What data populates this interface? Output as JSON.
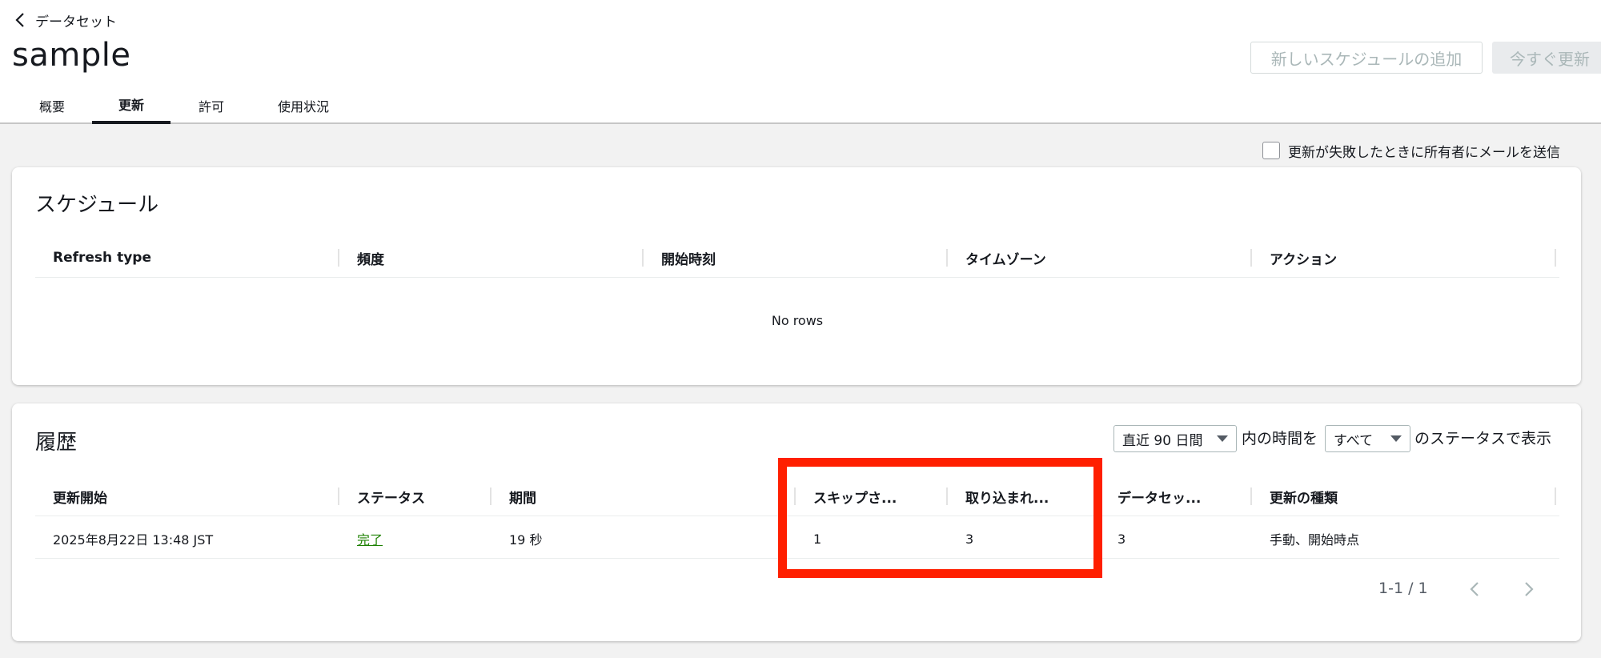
{
  "header": {
    "back_label": "データセット",
    "title": "sample",
    "add_schedule_label": "新しいスケジュールの追加",
    "refresh_now_label": "今すぐ更新"
  },
  "tabs": [
    {
      "label": "概要",
      "active": false
    },
    {
      "label": "更新",
      "active": true
    },
    {
      "label": "許可",
      "active": false
    },
    {
      "label": "使用状況",
      "active": false
    }
  ],
  "notify_label": "更新が失敗したときに所有者にメールを送信",
  "schedule": {
    "title": "スケジュール",
    "columns": [
      "Refresh type",
      "頻度",
      "開始時刻",
      "タイムゾーン",
      "アクション"
    ],
    "empty_text": "No rows"
  },
  "history": {
    "title": "履歴",
    "filter": {
      "range_value": "直近 90 日間",
      "text_middle": "内の時間を",
      "status_value": "すべて",
      "text_end": "のステータスで表示"
    },
    "columns": [
      "更新開始",
      "ステータス",
      "期間",
      "スキップさ...",
      "取り込まれ...",
      "データセッ...",
      "更新の種類"
    ],
    "rows": [
      {
        "start": "2025年8月22日 13:48 JST",
        "status": "完了",
        "duration": "19 秒",
        "skipped": "1",
        "ingested": "3",
        "dataset": "3",
        "type": "手動、開始時点"
      }
    ],
    "pagination": "1-1 / 1"
  },
  "colors": {
    "highlight": "#ff1f00",
    "status_success": "#1d8102"
  }
}
